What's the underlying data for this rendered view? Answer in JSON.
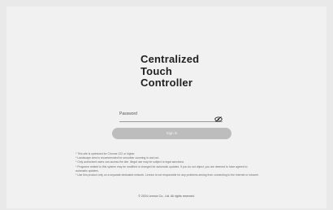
{
  "login": {
    "title_lines": [
      "Centralized",
      "Touch",
      "Controller"
    ],
    "password": {
      "placeholder": "Password",
      "value": ""
    },
    "signin_label": "Sign in"
  },
  "notes": [
    "* This site is optimized for Chrome 122 or higher.",
    "* Landscape view is recommended for smoother zooming in and out.",
    "* Only authorized users can access the site. Illegal use may be subject to legal sanctions.",
    "* Programs related to this system may be modified or changed for automatic updates. If you do not object, you are deemed to have agreed to automatic updates.",
    "* Use this product only on a separate dedicated network. Lennox is not responsible for any problems arising from connecting to the Internet or intranet."
  ],
  "footer": {
    "copyright": "© 2024 Lennox Co., Ltd. All rights reserved."
  },
  "colors": {
    "background": "#e9e9e9",
    "panel": "#f1f1f1",
    "button": "#bdbdbd",
    "title": "#1f1f1f"
  },
  "icons": {
    "password_toggle": "eye-off-icon"
  }
}
